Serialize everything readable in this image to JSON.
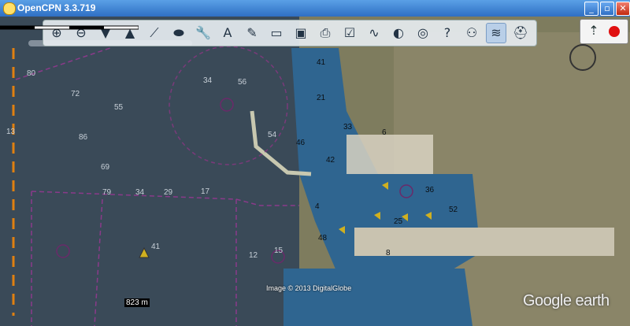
{
  "window": {
    "title": "OpenCPN 3.3.719",
    "minimize_glyph": "_",
    "maximize_glyph": "▫",
    "close_glyph": "✕"
  },
  "toolbar": {
    "icons": [
      {
        "name": "zoom-in-icon",
        "glyph": "⊕"
      },
      {
        "name": "zoom-out-icon",
        "glyph": "⊖"
      },
      {
        "name": "scale-in-icon",
        "glyph": "▼"
      },
      {
        "name": "scale-out-icon",
        "glyph": "▲"
      },
      {
        "name": "route-icon",
        "glyph": "⟋"
      },
      {
        "name": "auto-follow-icon",
        "glyph": "⬬"
      },
      {
        "name": "settings-icon",
        "glyph": "🔧"
      },
      {
        "name": "text-icon",
        "glyph": "A"
      },
      {
        "name": "current-icon",
        "glyph": "✎"
      },
      {
        "name": "tide-icon",
        "glyph": "▭"
      },
      {
        "name": "route-manager-icon",
        "glyph": "▣"
      },
      {
        "name": "print-icon",
        "glyph": "⎙"
      },
      {
        "name": "track-icon",
        "glyph": "☑"
      },
      {
        "name": "track-record-icon",
        "glyph": "∿"
      },
      {
        "name": "color-scheme-icon",
        "glyph": "◐"
      },
      {
        "name": "mob-icon",
        "glyph": "◎"
      },
      {
        "name": "help-icon",
        "glyph": "?"
      },
      {
        "name": "ais-icon",
        "glyph": "⚇"
      },
      {
        "name": "chart-quilt-icon",
        "glyph": "≋"
      },
      {
        "name": "toggle-overlay-icon",
        "glyph": "⛑"
      }
    ]
  },
  "status": {
    "scale_label": "823 m",
    "image_credit": "Image © 2013 DigitalGlobe",
    "google_label": "Google earth"
  },
  "depths": [
    "80",
    "72",
    "55",
    "86",
    "69",
    "79",
    "34",
    "29",
    "54",
    "56",
    "41",
    "21",
    "46",
    "42",
    "33",
    "17",
    "41",
    "36",
    "15",
    "12",
    "48",
    "25",
    "34",
    "6",
    "52",
    "4",
    "13",
    "8"
  ]
}
